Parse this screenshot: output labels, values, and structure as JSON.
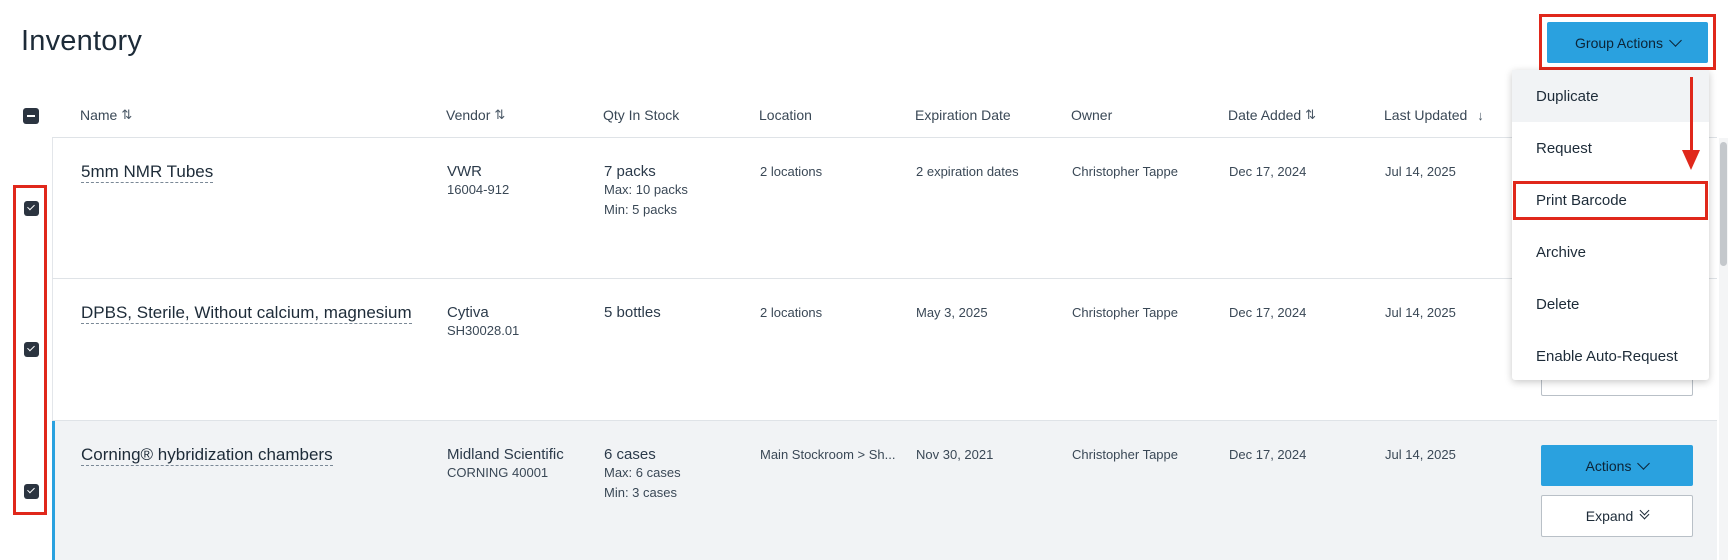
{
  "page": {
    "title": "Inventory"
  },
  "group_actions": {
    "label": "Group Actions",
    "menu": [
      "Duplicate",
      "Request",
      "Print Barcode",
      "Archive",
      "Delete",
      "Enable Auto-Request"
    ],
    "highlighted_item": "Print Barcode"
  },
  "table": {
    "columns": [
      "Name",
      "Vendor",
      "Qty In Stock",
      "Location",
      "Expiration Date",
      "Owner",
      "Date Added",
      "Last Updated"
    ],
    "rows": [
      {
        "name": "5mm NMR Tubes",
        "vendor": "VWR",
        "vendor_sku": "16004-912",
        "qty": "7 packs",
        "qty_max": "Max: 10 packs",
        "qty_min": "Min: 5 packs",
        "location": "2 locations",
        "expiration": "2 expiration dates",
        "owner": "Christopher Tappe",
        "date_added": "Dec 17, 2024",
        "last_updated": "Jul 14, 2025",
        "checked": true
      },
      {
        "name": "DPBS, Sterile, Without calcium, magnesium",
        "vendor": "Cytiva",
        "vendor_sku": "SH30028.01",
        "qty": "5 bottles",
        "location": "2 locations",
        "expiration": "May 3, 2025",
        "owner": "Christopher Tappe",
        "date_added": "Dec 17, 2024",
        "last_updated": "Jul 14, 2025",
        "checked": true
      },
      {
        "name": "Corning® hybridization chambers",
        "vendor": "Midland Scientific",
        "vendor_sku": "CORNING 40001",
        "qty": "6 cases",
        "qty_max": "Max: 6 cases",
        "qty_min": "Min: 3 cases",
        "location": "Main Stockroom > Sh...",
        "expiration": "Nov 30, 2021",
        "owner": "Christopher Tappe",
        "date_added": "Dec 17, 2024",
        "last_updated": "Jul 14, 2025",
        "checked": true,
        "actions_label": "Actions",
        "expand_label": "Expand"
      }
    ]
  },
  "colors": {
    "primary_blue": "#2aa1df",
    "annotation_red": "#e0281b",
    "text_dark": "#1d2b38"
  }
}
